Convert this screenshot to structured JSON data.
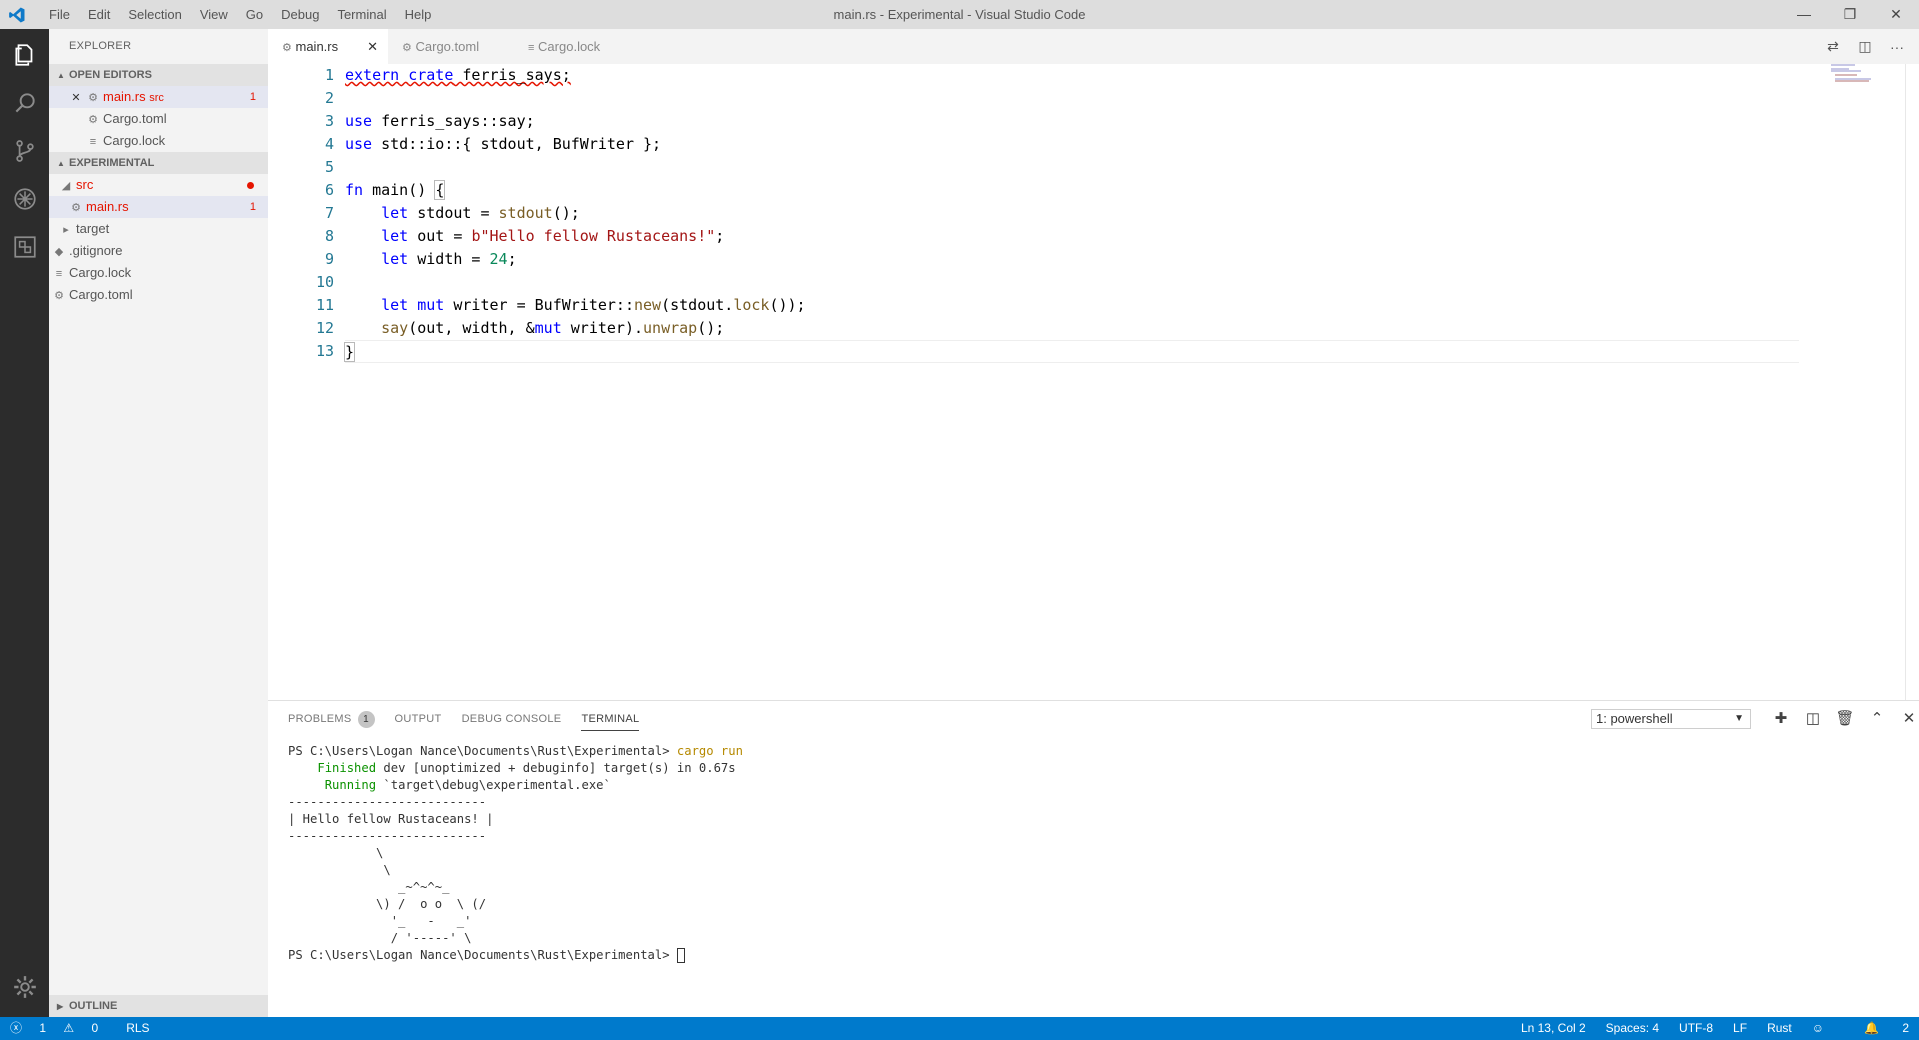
{
  "window": {
    "title": "main.rs - Experimental - Visual Studio Code",
    "menu": [
      "File",
      "Edit",
      "Selection",
      "View",
      "Go",
      "Debug",
      "Terminal",
      "Help"
    ],
    "controls": [
      "—",
      "❐",
      "✕"
    ]
  },
  "activity_bar": [
    "explorer-icon",
    "search-icon",
    "source-control-icon",
    "debug-icon",
    "extensions-icon",
    "gear-icon"
  ],
  "sidebar": {
    "title": "EXPLORER",
    "open_editors": {
      "header": "OPEN EDITORS",
      "items": [
        {
          "name": "main.rs",
          "hint": "src",
          "badge": "1"
        },
        {
          "name": "Cargo.toml"
        },
        {
          "name": "Cargo.lock"
        }
      ]
    },
    "project": {
      "header": "EXPERIMENTAL",
      "items": [
        {
          "name": "src"
        },
        {
          "name": "main.rs",
          "badge": "1"
        },
        {
          "name": "target"
        },
        {
          "name": ".gitignore"
        },
        {
          "name": "Cargo.lock"
        },
        {
          "name": "Cargo.toml"
        }
      ]
    },
    "outline": "OUTLINE"
  },
  "tabs": [
    {
      "label": "main.rs"
    },
    {
      "label": "Cargo.toml"
    },
    {
      "label": "Cargo.lock"
    }
  ],
  "editor": {
    "line_numbers": [
      "1",
      "2",
      "3",
      "4",
      "5",
      "6",
      "7",
      "8",
      "9",
      "10",
      "11",
      "12",
      "13"
    ]
  },
  "panel": {
    "tabs": [
      "PROBLEMS",
      "OUTPUT",
      "DEBUG CONSOLE",
      "TERMINAL"
    ],
    "problems_count": "1",
    "terminal_select": "1: powershell",
    "terminal": {
      "prompt": "PS C:\\Users\\Logan Nance\\Documents\\Rust\\Experimental> ",
      "command": "cargo run",
      "finished_word": "Finished",
      "finished_rest": " dev [unoptimized + debuginfo] target(s) in 0.67s",
      "running_word": "Running",
      "running_rest": " `target\\debug\\experimental.exe`",
      "art": [
        "---------------------------",
        "| Hello fellow Rustaceans! |",
        "---------------------------",
        "            \\",
        "             \\",
        "               _~^~^~_",
        "            \\) /  o o  \\ (/",
        "              '_   -   _'",
        "              / '-----' \\"
      ]
    }
  },
  "status_bar": {
    "errors": "1",
    "warnings": "0",
    "rls": "RLS",
    "position": "Ln 13, Col 2",
    "spaces": "Spaces: 4",
    "encoding": "UTF-8",
    "eol": "LF",
    "language": "Rust",
    "notifications": "2"
  }
}
